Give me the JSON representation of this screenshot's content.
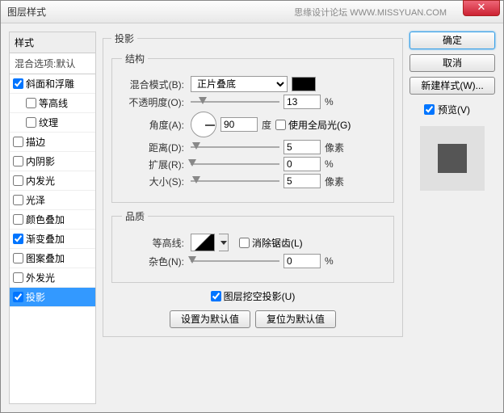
{
  "window": {
    "title": "图层样式",
    "subtitle": "思缘设计论坛  WWW.MISSYUAN.COM"
  },
  "sidebar": {
    "header": "样式",
    "sub": "混合选项:默认",
    "items": [
      {
        "label": "斜面和浮雕",
        "checked": true
      },
      {
        "label": "等高线",
        "checked": false,
        "sub": true
      },
      {
        "label": "纹理",
        "checked": false,
        "sub": true
      },
      {
        "label": "描边",
        "checked": false
      },
      {
        "label": "内阴影",
        "checked": false
      },
      {
        "label": "内发光",
        "checked": false
      },
      {
        "label": "光泽",
        "checked": false
      },
      {
        "label": "颜色叠加",
        "checked": false
      },
      {
        "label": "渐变叠加",
        "checked": true
      },
      {
        "label": "图案叠加",
        "checked": false
      },
      {
        "label": "外发光",
        "checked": false
      },
      {
        "label": "投影",
        "checked": true,
        "selected": true
      }
    ]
  },
  "panel": {
    "title": "投影",
    "structure_title": "结构",
    "blendmode_label": "混合模式(B):",
    "blendmode_value": "正片叠底",
    "opacity_label": "不透明度(O):",
    "opacity_value": "13",
    "percent": "%",
    "angle_label": "角度(A):",
    "angle_value": "90",
    "angle_unit": "度",
    "global_light": "使用全局光(G)",
    "distance_label": "距离(D):",
    "distance_value": "5",
    "px": "像素",
    "spread_label": "扩展(R):",
    "spread_value": "0",
    "size_label": "大小(S):",
    "size_value": "5",
    "quality_title": "品质",
    "contour_label": "等高线:",
    "antialias_label": "消除锯齿(L)",
    "noise_label": "杂色(N):",
    "noise_value": "0",
    "knockout": "图层挖空投影(U)",
    "make_default": "设置为默认值",
    "reset_default": "复位为默认值"
  },
  "buttons": {
    "ok": "确定",
    "cancel": "取消",
    "new_style": "新建样式(W)...",
    "preview": "预览(V)"
  }
}
